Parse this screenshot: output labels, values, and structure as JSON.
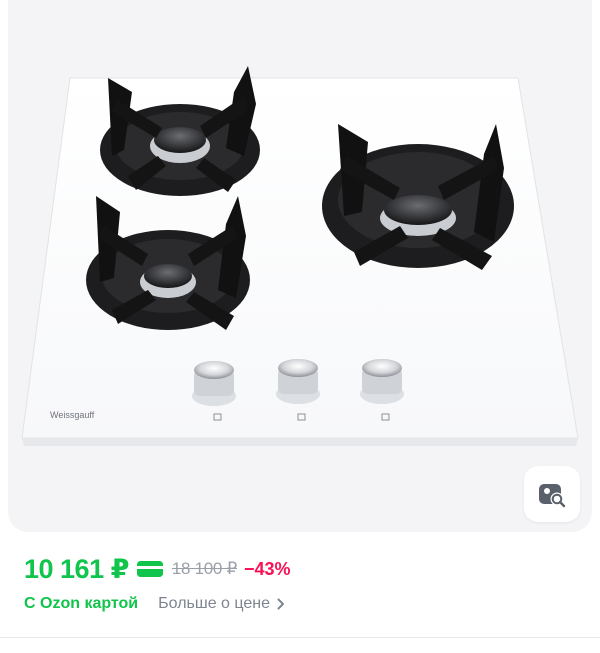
{
  "product": {
    "brand_mark": "Weissgauff"
  },
  "pricing": {
    "current_price": "10 161 ₽",
    "old_price": "18 100 ₽",
    "discount": "−43%",
    "card_label": "С Ozon картой",
    "more_link": "Больше о цене"
  },
  "icons": {
    "visual_search": "image-search-icon",
    "payment_card": "card-icon",
    "more_chevron": "chevron-right-icon"
  },
  "colors": {
    "price_green": "#10c44c",
    "discount_red": "#f91155",
    "muted_gray": "#9aa0a9",
    "gallery_bg": "#f4f4f6"
  }
}
